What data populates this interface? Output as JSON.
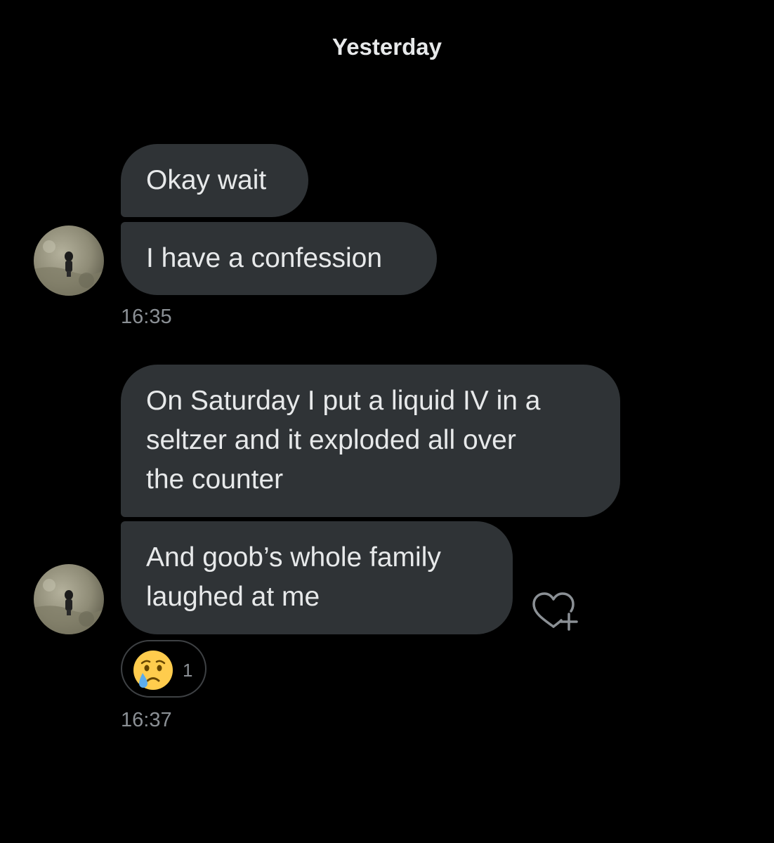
{
  "date_header": "Yesterday",
  "colors": {
    "background": "#000000",
    "bubble": "#2f3336",
    "text": "#e7e9ea",
    "muted": "#8b9095"
  },
  "groups": [
    {
      "messages": [
        {
          "lines": [
            "Okay wait"
          ]
        },
        {
          "lines": [
            "I have a confession"
          ]
        }
      ],
      "timestamp": "16:35",
      "avatar_icon": "user-avatar-photo"
    },
    {
      "messages": [
        {
          "lines": [
            "On Saturday I put a liquid IV in a",
            "seltzer and it exploded all over",
            "the counter"
          ]
        },
        {
          "lines": [
            "And goob’s whole family",
            "laughed at me"
          ]
        }
      ],
      "reaction": {
        "emoji": "crying-face-icon",
        "count": "1"
      },
      "timestamp": "16:37",
      "avatar_icon": "user-avatar-photo"
    }
  ],
  "add_reaction_icon": "heart-plus-icon"
}
